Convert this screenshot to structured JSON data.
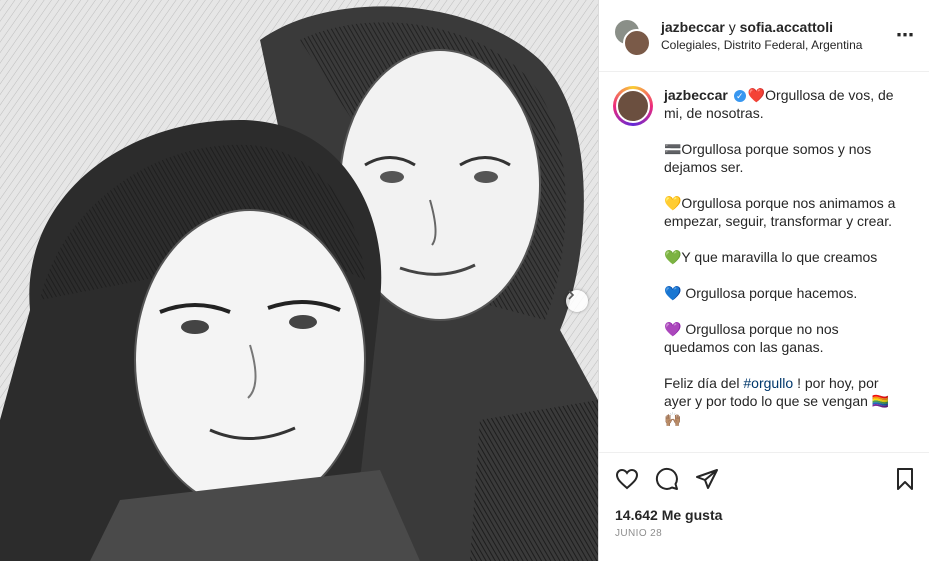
{
  "header": {
    "user1": "jazbeccar",
    "connector": " y ",
    "user2": "sofia.accattoli",
    "location": "Colegiales, Distrito Federal, Argentina",
    "more_icon": "⋯"
  },
  "caption": {
    "username": "jazbeccar",
    "verified_icon": "✓",
    "line1": "❤️Orgullosa de vos, de mi, de nosotras.",
    "line2": "🟰Orgullosa porque somos y nos dejamos ser.",
    "line3": "💛Orgullosa porque nos animamos a empezar, seguir, transformar y crear.",
    "line4": "💚Y que maravilla lo que creamos",
    "line5": "💙 Orgullosa porque hacemos.",
    "line6": "💜 Orgullosa porque no nos quedamos con las ganas.",
    "line7_pre": "Feliz día del ",
    "line7_tag": "#orgullo",
    "line7_post": " ! por hoy, por ayer y por todo lo que se vengan 🏳️‍🌈 🙌🏽"
  },
  "stats": {
    "likes": "14.642 Me gusta",
    "date": "JUNIO 28"
  },
  "colors": {
    "accent": "#3897f0",
    "hashtag": "#00376b",
    "muted": "#8e8e8e"
  }
}
